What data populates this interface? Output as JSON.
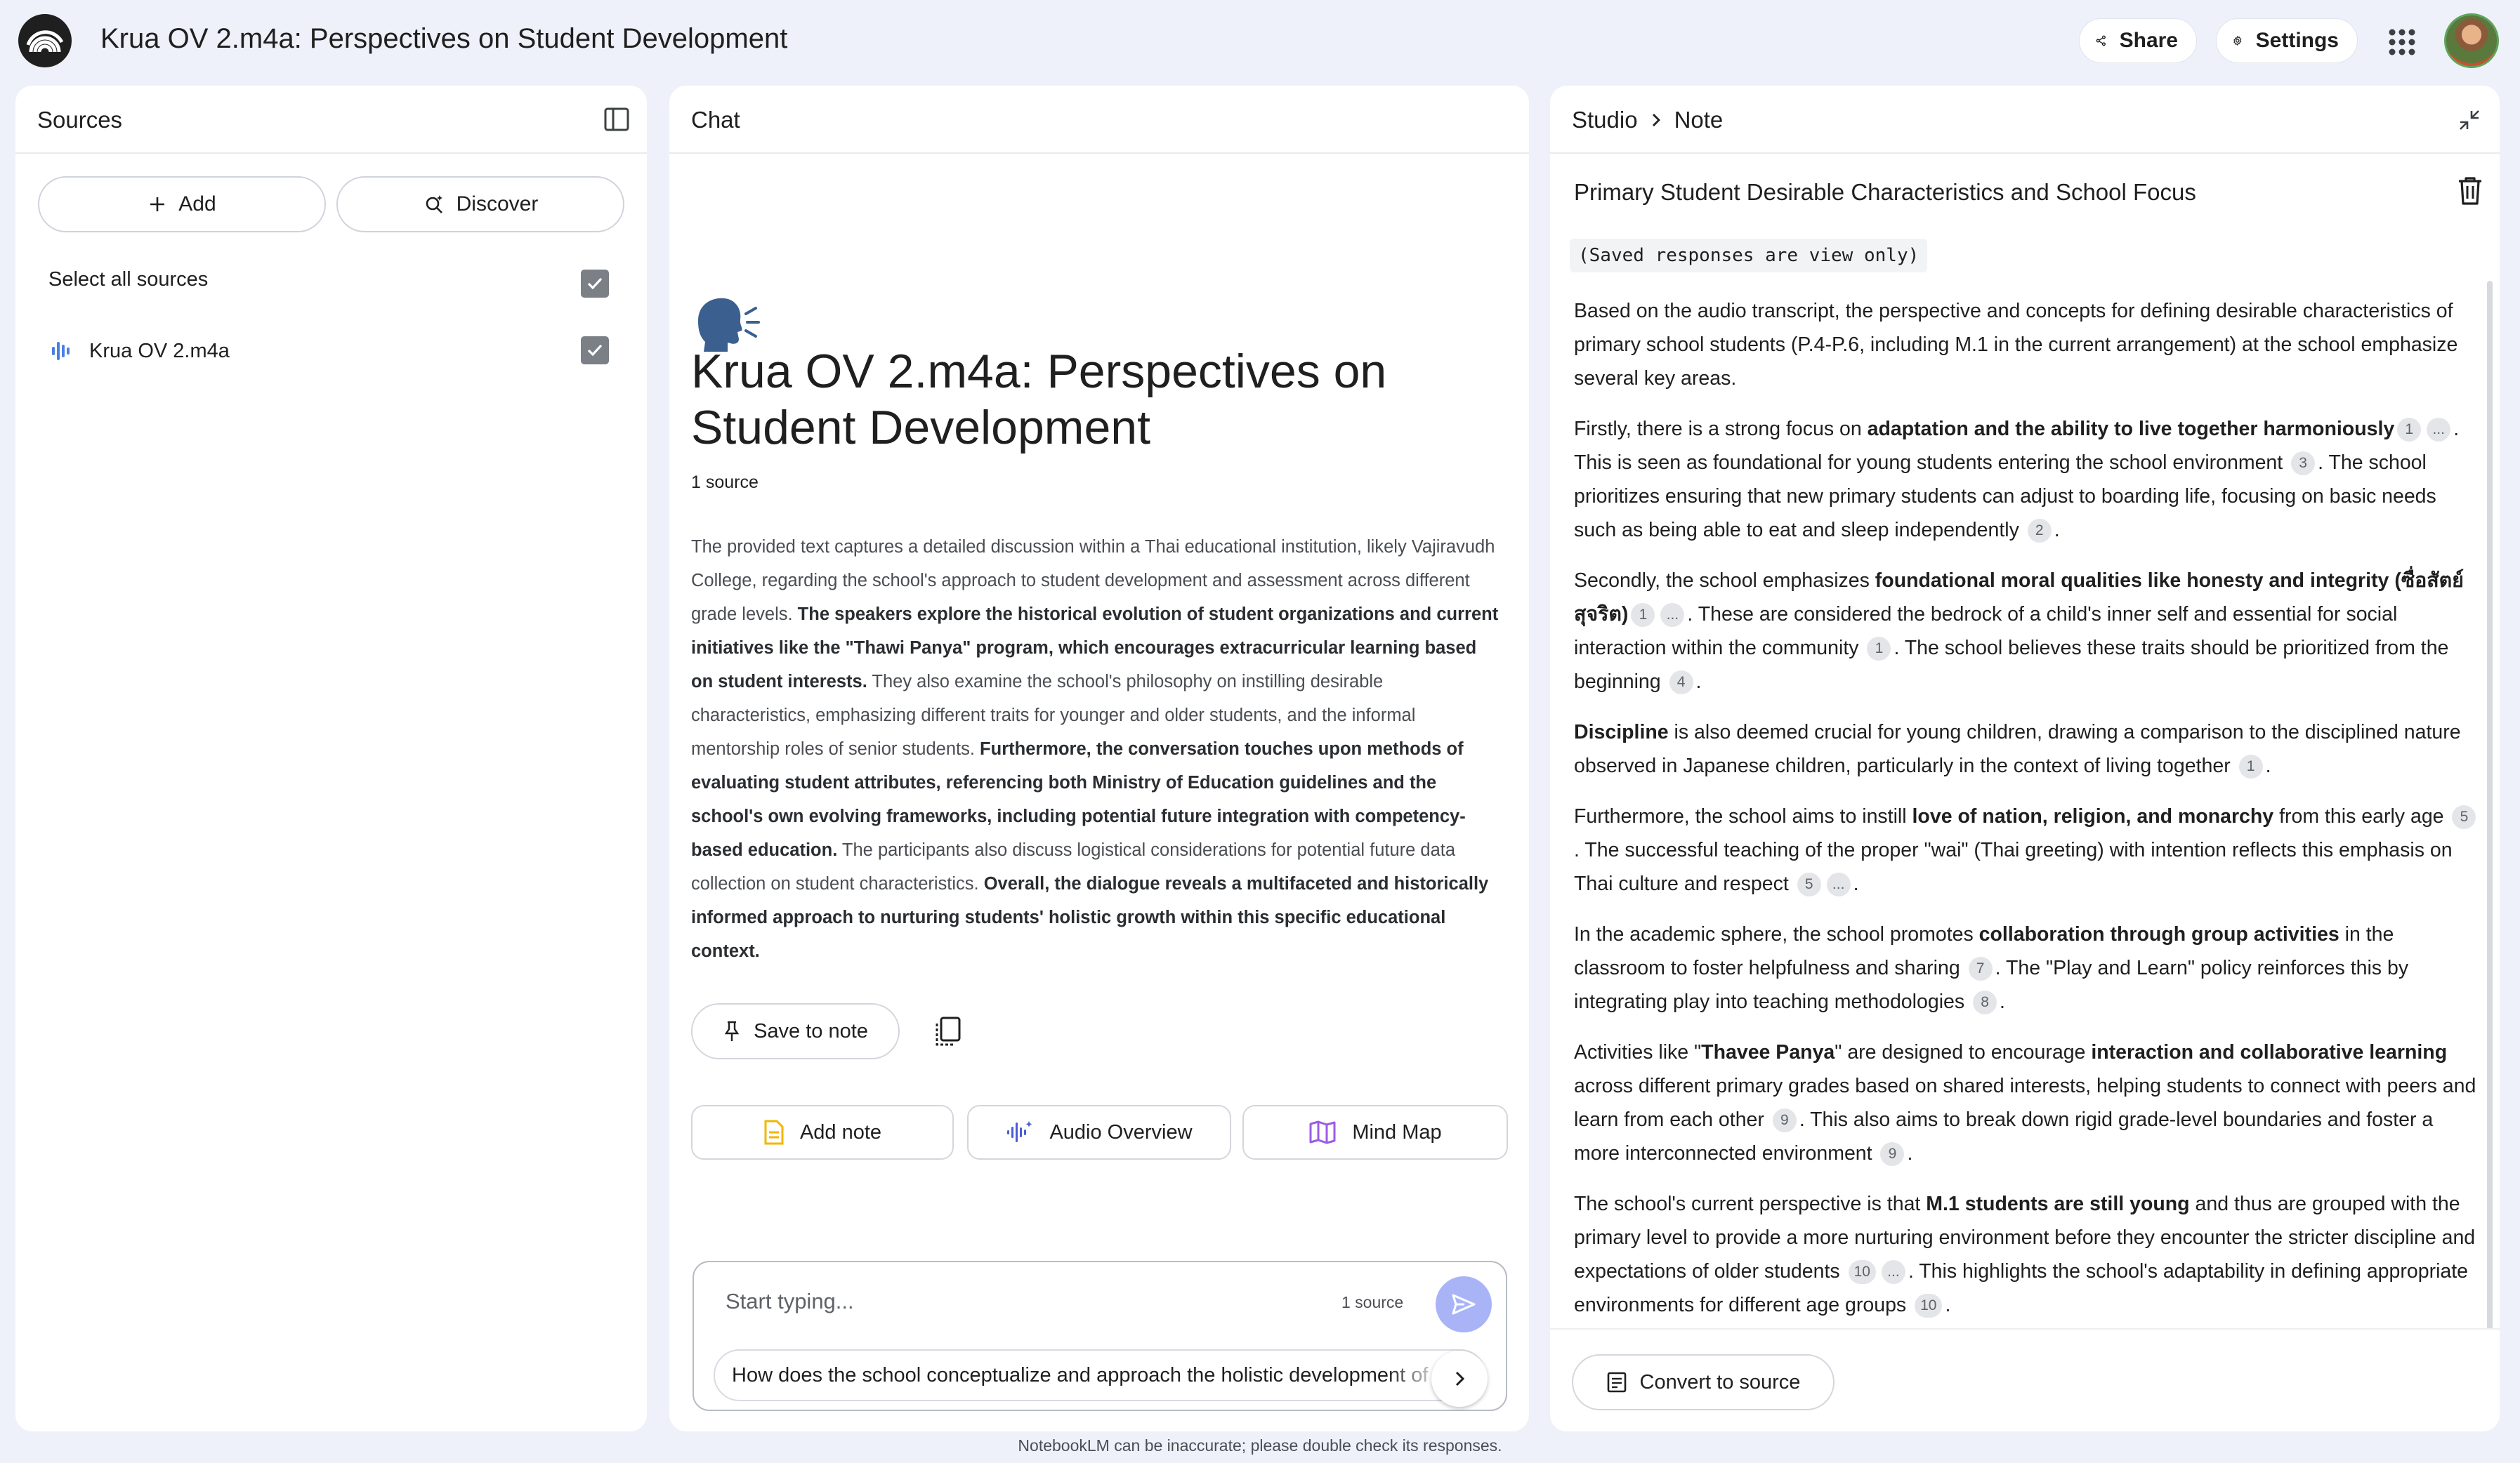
{
  "header": {
    "app_title": "Krua OV 2.m4a: Perspectives on Student Development",
    "share_label": "Share",
    "settings_label": "Settings"
  },
  "sources": {
    "title": "Sources",
    "add_label": "Add",
    "discover_label": "Discover",
    "select_all_label": "Select all sources",
    "select_all_checked": true,
    "items": [
      {
        "name": "Krua OV 2.m4a",
        "checked": true,
        "icon": "audio-waveform-icon"
      }
    ]
  },
  "chat": {
    "title": "Chat",
    "notebook_title": "Krua OV 2.m4a: Perspectives on Student Development",
    "source_count": "1 source",
    "summary": [
      {
        "text": "The provided text captures a detailed discussion within a Thai educational institution, likely Vajiravudh College, regarding the school's approach to student development and assessment across different grade levels. ",
        "bold": false
      },
      {
        "text": "The speakers explore the historical evolution of student organizations and current initiatives like the \"Thawi Panya\" program, which encourages extracurricular learning based on student interests.",
        "bold": true
      },
      {
        "text": " They also examine the school's philosophy on instilling desirable characteristics, emphasizing different traits for younger and older students, and the informal mentorship roles of senior students. ",
        "bold": false
      },
      {
        "text": "Furthermore, the conversation touches upon methods of evaluating student attributes, referencing both Ministry of Education guidelines and the school's own evolving frameworks, including potential future integration with competency-based education.",
        "bold": true
      },
      {
        "text": " The participants also discuss logistical considerations for potential future data collection on student characteristics. ",
        "bold": false
      },
      {
        "text": "Overall, the dialogue reveals a multifaceted and historically informed approach to nurturing students' holistic growth within this specific educational context.",
        "bold": true
      }
    ],
    "save_to_note_label": "Save to note",
    "add_note_label": "Add note",
    "audio_overview_label": "Audio Overview",
    "mind_map_label": "Mind Map",
    "input_placeholder": "Start typing...",
    "input_source_count": "1 source",
    "suggestion": "How does the school conceptualize and approach the holistic development of students"
  },
  "studio": {
    "breadcrumb_root": "Studio",
    "breadcrumb_current": "Note",
    "note_title": "Primary Student Desirable Characteristics and School Focus",
    "view_only_label": "(Saved responses are view only)",
    "paragraphs": [
      [
        {
          "t": "Based on the audio transcript, the perspective and concepts for defining desirable characteristics of primary school students (P.4-P.6, including M.1 in the current arrangement) at the school emphasize several key areas."
        }
      ],
      [
        {
          "t": "Firstly, there is a strong focus on "
        },
        {
          "t": "adaptation and the ability to live together harmoniously",
          "b": true
        },
        {
          "c": "1"
        },
        {
          "c": "..."
        },
        {
          "t": ". This is seen as foundational for young students entering the school environment "
        },
        {
          "c": "3"
        },
        {
          "t": ". The school prioritizes ensuring that new primary students can adjust to boarding life, focusing on basic needs such as being able to eat and sleep independently "
        },
        {
          "c": "2"
        },
        {
          "t": "."
        }
      ],
      [
        {
          "t": "Secondly, the school emphasizes "
        },
        {
          "t": "foundational moral qualities like honesty and integrity (ซื่อสัตย์สุจริต)",
          "b": true
        },
        {
          "c": "1"
        },
        {
          "c": "..."
        },
        {
          "t": ". These are considered the bedrock of a child's inner self and essential for social interaction within the community "
        },
        {
          "c": "1"
        },
        {
          "t": ". The school believes these traits should be prioritized from the beginning "
        },
        {
          "c": "4"
        },
        {
          "t": "."
        }
      ],
      [
        {
          "t": "Discipline",
          "b": true
        },
        {
          "t": " is also deemed crucial for young children, drawing a comparison to the disciplined nature observed in Japanese children, particularly in the context of living together "
        },
        {
          "c": "1"
        },
        {
          "t": "."
        }
      ],
      [
        {
          "t": "Furthermore, the school aims to instill "
        },
        {
          "t": "love of nation, religion, and monarchy",
          "b": true
        },
        {
          "t": " from this early age "
        },
        {
          "c": "5"
        },
        {
          "t": ". The successful teaching of the proper \"wai\" (Thai greeting) with intention reflects this emphasis on Thai culture and respect "
        },
        {
          "c": "5"
        },
        {
          "c": "..."
        },
        {
          "t": "."
        }
      ],
      [
        {
          "t": "In the academic sphere, the school promotes "
        },
        {
          "t": "collaboration through group activities",
          "b": true
        },
        {
          "t": " in the classroom to foster helpfulness and sharing "
        },
        {
          "c": "7"
        },
        {
          "t": ". The \"Play and Learn\" policy reinforces this by integrating play into teaching methodologies "
        },
        {
          "c": "8"
        },
        {
          "t": "."
        }
      ],
      [
        {
          "t": "Activities like \""
        },
        {
          "t": "Thavee Panya",
          "b": true
        },
        {
          "t": "\" are designed to encourage "
        },
        {
          "t": "interaction and collaborative learning",
          "b": true
        },
        {
          "t": " across different primary grades based on shared interests, helping students to connect with peers and learn from each other "
        },
        {
          "c": "9"
        },
        {
          "t": ". This also aims to break down rigid grade-level boundaries and foster a more interconnected environment "
        },
        {
          "c": "9"
        },
        {
          "t": "."
        }
      ],
      [
        {
          "t": "The school's current perspective is that "
        },
        {
          "t": "M.1 students are still young",
          "b": true
        },
        {
          "t": " and thus are grouped with the primary level to provide a more nurturing environment before they encounter the stricter discipline and expectations of older students "
        },
        {
          "c": "10"
        },
        {
          "c": "..."
        },
        {
          "t": ". This highlights the school's adaptability in defining appropriate environments for different age groups "
        },
        {
          "c": "10"
        },
        {
          "t": "."
        }
      ]
    ],
    "convert_label": "Convert to source"
  },
  "footer": {
    "disclaimer": "NotebookLM can be inaccurate; please double check its responses."
  },
  "colors": {
    "background": "#eef1f9",
    "panel": "#ffffff",
    "send_button": "#a9b4f7",
    "add_note_icon": "#f2b600",
    "audio_icon": "#4a5bd8",
    "mind_map_icon": "#9b5de5",
    "source_icon": "#4a7fe5"
  }
}
